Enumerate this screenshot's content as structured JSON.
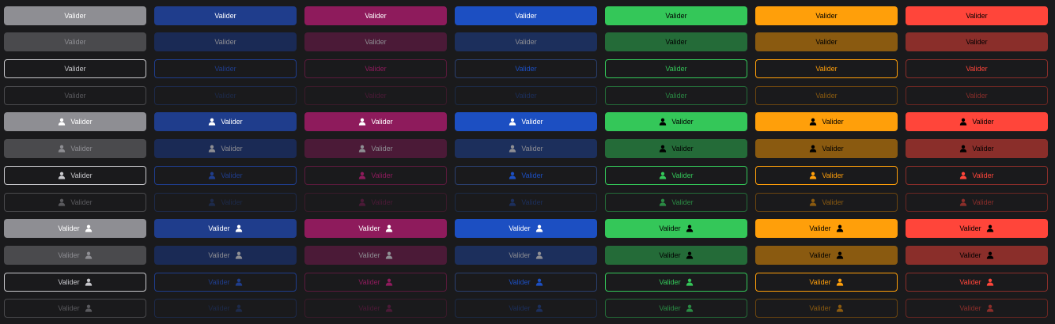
{
  "button_label": "Valider",
  "icon": "user-icon",
  "columns": [
    {
      "name": "neutral",
      "color": "#8e8e93",
      "solid_text": "#ffffff",
      "soft_bg": "#4a4a4d",
      "soft_text": "#8e8e93",
      "outline_text": "#c8c8cc",
      "outline_border": "#c8c8cc",
      "ghost_border": "#4a4a4d",
      "ghost_text": "#5a5a5e"
    },
    {
      "name": "navy",
      "color": "#1f3d8c",
      "solid_text": "#ffffff",
      "soft_bg": "#1a2a55",
      "soft_text": "#8e8e93",
      "outline_text": "#1f3d8c",
      "outline_border": "#1f3d8c",
      "ghost_border": "#1d2a4a",
      "ghost_text": "#1d2a4a"
    },
    {
      "name": "magenta",
      "color": "#8e1b5c",
      "solid_text": "#ffffff",
      "soft_bg": "#4b1a37",
      "soft_text": "#8e8e93",
      "outline_text": "#8e1b5c",
      "outline_border": "#5a1a3c",
      "ghost_border": "#3a1a2a",
      "ghost_text": "#4b1a37"
    },
    {
      "name": "blue",
      "color": "#1c4fc2",
      "solid_text": "#ffffff",
      "soft_bg": "#1c2f5c",
      "soft_text": "#8e8e93",
      "outline_text": "#1c4fc2",
      "outline_border": "#2a3f6e",
      "ghost_border": "#1c2a45",
      "ghost_text": "#1c2f5c"
    },
    {
      "name": "green",
      "color": "#34c759",
      "solid_text": "#000000",
      "soft_bg": "#246b38",
      "soft_text": "#000000",
      "outline_text": "#34c759",
      "outline_border": "#34c759",
      "ghost_border": "#246b38",
      "ghost_text": "#2a8a44"
    },
    {
      "name": "orange",
      "color": "#ff9f0a",
      "solid_text": "#000000",
      "soft_bg": "#8a5a10",
      "soft_text": "#000000",
      "outline_text": "#ff9f0a",
      "outline_border": "#ff9f0a",
      "ghost_border": "#6b4510",
      "ghost_text": "#8a5a10"
    },
    {
      "name": "red",
      "color": "#ff453a",
      "solid_text": "#000000",
      "soft_bg": "#8a2e2a",
      "soft_text": "#000000",
      "outline_text": "#ff453a",
      "outline_border": "#8a2e2a",
      "ghost_border": "#6a2622",
      "ghost_text": "#8a2e2a"
    }
  ],
  "row_variants": [
    "solid",
    "soft",
    "outline",
    "ghost"
  ],
  "row_icon_modes": [
    "none",
    "left",
    "right"
  ]
}
